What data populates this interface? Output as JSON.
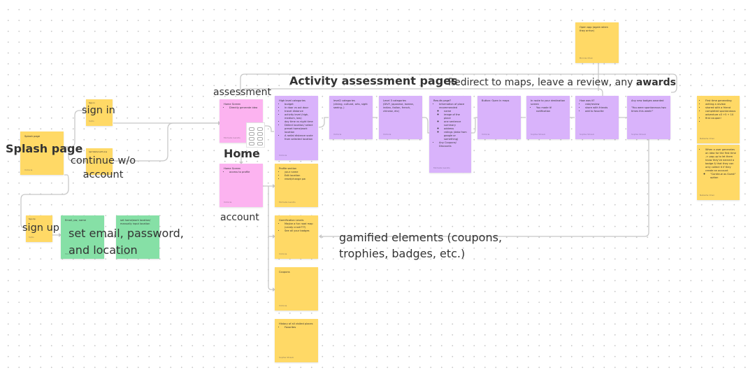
{
  "labels": {
    "splash_page": "Splash page",
    "sign_in": "sign in",
    "continue_without_account": "continue w/o account",
    "sign_up": "sign up",
    "set_email_password_location": "set email, password, and location",
    "assessment": "assessment",
    "home": "Home",
    "account": "account",
    "activity_assessment_pages": "Activity assessment pages",
    "redirect_prefix": "Redirect to maps, leave a review, any",
    "redirect_bold": "awards",
    "gamified_elements": "gamified elements (coupons, trophies, badges, etc.)"
  },
  "stickies": {
    "splash": {
      "title": "Splash page",
      "author": "Victoria"
    },
    "sign_in": {
      "title": "Sign in",
      "author": "Sophia"
    },
    "continue_guest": {
      "title": "Get Started with Ana",
      "author": "Sophia"
    },
    "sign_up": {
      "title": "Sign Up",
      "author": "Sophia"
    },
    "email_pw_name": {
      "title": "Email, pw, name",
      "author": "Michelle"
    },
    "home_location": {
      "title": "set home/work location/ manually input location",
      "author": "Victoria"
    },
    "home_screen_1": {
      "title": "Home Screen",
      "items": [
        "Directly generate idea"
      ],
      "author": "Michelle Gendls"
    },
    "home_screen_2": {
      "title": "Home Screen",
      "items": [
        "access to profile"
      ],
      "author": "Victoria"
    },
    "high_level": {
      "title": "High level categories",
      "items": [
        "budget",
        "in door vs out door",
        "travel distance",
        "activity level (high, medium, low)",
        "day time vs night time",
        "Detect location/ select preset home/work location",
        "A radial distance scale from selected location"
      ],
      "author": "Victoria"
    },
    "level2": {
      "title": "level2  categories",
      "body": "(dining, cultural, arts, sight seeing..)",
      "author": "Victoria"
    },
    "level3": {
      "title": "Level 3 categories",
      "body": "(DIVY, japanese, korean, indian, italian, french, chinese, etc)",
      "author": "Victoria"
    },
    "results": {
      "title": "Results page?",
      "items": [
        "Information of place recommended"
      ],
      "subitems": [
        "name",
        "image of the place",
        "one sentence summary",
        "address",
        "ratings (data from google or something)"
      ],
      "items_after": [
        "Any Coupons/ Discounts"
      ],
      "author": "Michelle Gendls"
    },
    "open_maps": {
      "title": "Button: Open in maps",
      "author": "Victoria"
    },
    "en_route": {
      "title": "In route to your destination screen",
      "items": [
        "You made it! notification"
      ],
      "author": "Sophia Straub"
    },
    "how_was_it": {
      "title": "How was it?",
      "items": [
        "rate/review",
        "share with friends",
        "add to favorite"
      ],
      "author": "Sophia Straub"
    },
    "badges": {
      "title": "Any new badges awarded",
      "body": "\"You were spontaneous two times this week!\"",
      "author": "Sophia Straub"
    },
    "open_app": {
      "title": "Open app (again when they arrive)",
      "author": "Bonnie Chan"
    },
    "profile": {
      "title": "Profile section",
      "items": [
        "your name",
        "Edit location",
        "reset/change pw"
      ],
      "author": "Michelle Gendls"
    },
    "gamification": {
      "title": "Gamification Levels",
      "items": [
        "Maybe a fun road map (candy crush???)",
        "See all your badges"
      ],
      "author": "Victoria"
    },
    "coupons": {
      "title": "Coupons",
      "author": "Victoria"
    },
    "history": {
      "title": "History of all visited places",
      "items": [
        "Favorites"
      ],
      "author": "Sophia Straub"
    },
    "badge_list": {
      "items": [
        "First time generating",
        "writing a review",
        "shared with a friend",
        "completed spontaneous adventure x3 +5 + 10",
        "first coupon!",
        ""
      ],
      "author": "Natasha Chan"
    },
    "guest_popup": {
      "items": [
        "When a user generates an idea for the first time -> pop-up to let them know they've earned a badge & that they can only collect it if they create an account"
      ],
      "subitems": [
        "\"Continue as Guest\" option"
      ],
      "author": "Natasha Chan"
    }
  },
  "colors": {
    "yellow": "#ffd966",
    "purple": "#d9b3fb",
    "pink": "#fcb3f0",
    "green": "#86e0a6",
    "connector": "#c8c8c8"
  }
}
